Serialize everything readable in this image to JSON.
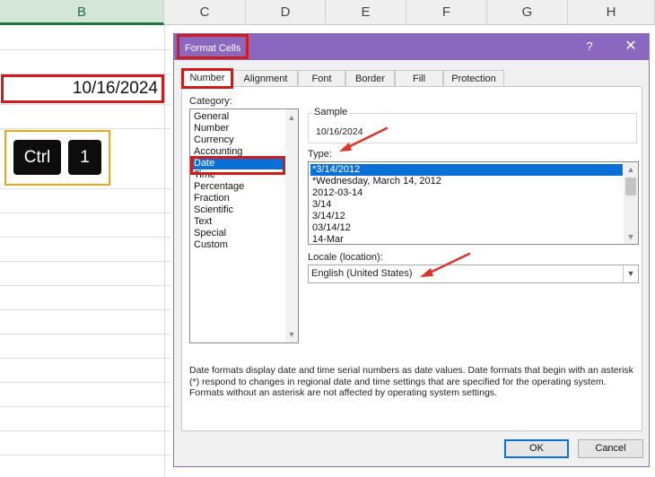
{
  "spreadsheet": {
    "columns": [
      {
        "name": "B",
        "selected": true
      },
      {
        "name": "C"
      },
      {
        "name": "D"
      },
      {
        "name": "E"
      },
      {
        "name": "F"
      },
      {
        "name": "G"
      },
      {
        "name": "H"
      }
    ],
    "cell_value": "10/16/2024",
    "shortcut_keys": [
      "Ctrl",
      "1"
    ]
  },
  "dialog": {
    "title": "Format Cells",
    "help_label": "?",
    "close_label": "✕",
    "tabs": [
      "Number",
      "Alignment",
      "Font",
      "Border",
      "Fill",
      "Protection"
    ],
    "active_tab": "Number",
    "category_label": "Category:",
    "categories": [
      "General",
      "Number",
      "Currency",
      "Accounting",
      "Date",
      "Time",
      "Percentage",
      "Fraction",
      "Scientific",
      "Text",
      "Special",
      "Custom"
    ],
    "selected_category": "Date",
    "sample_label": "Sample",
    "sample_value": "10/16/2024",
    "type_label": "Type:",
    "types": [
      "*3/14/2012",
      "*Wednesday, March 14, 2012",
      "2012-03-14",
      "3/14",
      "3/14/12",
      "03/14/12",
      "14-Mar"
    ],
    "selected_type": "*3/14/2012",
    "locale_label": "Locale (location):",
    "locale_value": "English (United States)",
    "description": "Date formats display date and time serial numbers as date values.  Date formats that begin with an asterisk (*) respond to changes in regional date and time settings that are specified for the operating system. Formats without an asterisk are not affected by operating system settings.",
    "ok_label": "OK",
    "cancel_label": "Cancel"
  },
  "colors": {
    "title_bar": "#8b68bf",
    "highlight_red": "#d11a1a",
    "highlight_orange": "#f0a61c",
    "selection_blue": "#0a6fd6",
    "excel_green": "#217346"
  },
  "icons": {
    "help": "question-mark-icon",
    "close": "close-icon",
    "scroll_up": "scroll-up-arrow-icon",
    "scroll_down": "scroll-down-arrow-icon",
    "dropdown": "chevron-down-icon",
    "annotation": "red-arrow-icon"
  }
}
